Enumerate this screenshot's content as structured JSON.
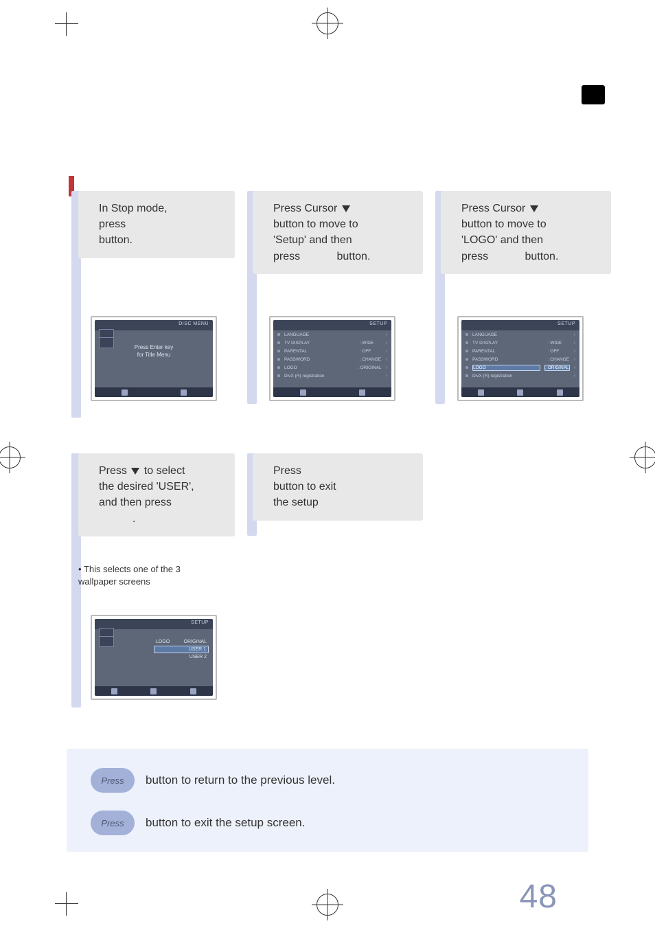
{
  "steps": {
    "s1": {
      "line1": "In Stop mode,",
      "line2": "press",
      "line3": "button."
    },
    "s2": {
      "line1a": "Press Cursor ",
      "line2": "button to move to",
      "line3": "'Setup' and then",
      "line4a": "press",
      "line4b": "button."
    },
    "s3": {
      "line1a": "Press Cursor ",
      "line2": "button to move to",
      "line3": "'LOGO' and then",
      "line4a": "press",
      "line4b": "button."
    },
    "s4": {
      "line1a": "Press ",
      "line1b": " to select",
      "line2": "the desired 'USER',",
      "line3": "and then press",
      "line4": "."
    },
    "s5": {
      "line1": "Press",
      "line2": "button to exit",
      "line3": "the setup"
    }
  },
  "note": "•  This selects one of the 3 wallpaper screens",
  "pills": {
    "label": "Press",
    "row1_text": "button to return to the previous level.",
    "row2_text": "button to exit the setup screen."
  },
  "page_number": "48",
  "screens": {
    "sc1": {
      "left_title": "",
      "right_title": "DISC MENU",
      "center1": "Press Enter key",
      "center2": "for Title Menu"
    },
    "sc2": {
      "left_title": "",
      "right_title": "SETUP",
      "rows": [
        {
          "k": "LANGUAGE",
          "v": ""
        },
        {
          "k": "TV DISPLAY",
          "v": ": WIDE"
        },
        {
          "k": "PARENTAL",
          "v": ": OFF"
        },
        {
          "k": "PASSWORD",
          "v": ": CHANGE"
        },
        {
          "k": "LOGO",
          "v": ": ORIGINAL"
        },
        {
          "k": "DivX (R) registration",
          "v": ""
        }
      ]
    },
    "sc3": {
      "left_title": "",
      "right_title": "SETUP",
      "rows": [
        {
          "k": "LANGUAGE",
          "v": ""
        },
        {
          "k": "TV DISPLAY",
          "v": ": WIDE"
        },
        {
          "k": "PARENTAL",
          "v": ": OFF"
        },
        {
          "k": "PASSWORD",
          "v": ": CHANGE"
        },
        {
          "k": "LOGO",
          "v": ": ORIGINAL",
          "hl": true
        },
        {
          "k": "DivX (R) registration",
          "v": ""
        }
      ]
    },
    "sc4": {
      "left_title": "",
      "right_title": "SETUP",
      "rows": [
        {
          "k": "LOGO",
          "v": "ORIGINAL"
        },
        {
          "k": "",
          "v": "USER 1",
          "hl": true
        },
        {
          "k": "",
          "v": "USER 2"
        }
      ]
    }
  }
}
